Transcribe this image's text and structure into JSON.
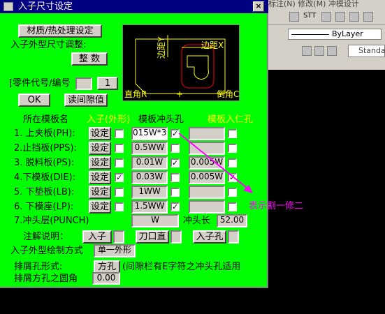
{
  "dialog": {
    "title": "入子尺寸设定",
    "close_glyph": "×",
    "material_button": "材质/热处理设定",
    "shape_adjust_label": "入子外型尺寸调整:",
    "integer_button": "整 数",
    "part_code_label": "[零件代号/编号",
    "part_code_value": "",
    "part_number_value": "1",
    "ok_button": "OK",
    "read_gap_button": "读间隙值",
    "preview": {
      "dim_edge_label": "边距Y",
      "dim_edge_label_x": "边距X",
      "corner_r_label": "直角R",
      "chamfer_label": "倒角C",
      "center_mark": "+"
    },
    "headers": {
      "template_name": "所在模板名",
      "insert_shape": "入子(外形)",
      "punch_hole": "模板冲头孔",
      "insert_hole": "模板入仁孔"
    },
    "rows": [
      {
        "name": "1. 上夹板(PH):",
        "set": "设定",
        "set_checked": false,
        "shape_value": "015W*3",
        "shape_checked": true,
        "punch_value": "",
        "punch_checked": false
      },
      {
        "name": "2.止挡板(PPS):",
        "set": "设定",
        "set_checked": false,
        "shape_value": "0.5WW",
        "shape_checked": false,
        "punch_value": "",
        "punch_checked": false
      },
      {
        "name": "3. 脱料板(PS):",
        "set": "设定",
        "set_checked": false,
        "shape_value": "0.01W",
        "shape_checked": true,
        "punch_value": "0.005W",
        "punch_checked": false
      },
      {
        "name": "4.下模板(DIE):",
        "set": "设定",
        "set_checked": true,
        "shape_value": "0.03W",
        "shape_checked": false,
        "punch_value": "0.005W",
        "punch_checked": true
      },
      {
        "name": "5. 下垫板(LB):",
        "set": "设定",
        "set_checked": false,
        "shape_value": "1WW",
        "shape_checked": false,
        "punch_value": "",
        "punch_checked": false
      },
      {
        "name": "6. 下模座(LP):",
        "set": "设定",
        "set_checked": false,
        "shape_value": "1.5WW",
        "shape_checked": true,
        "punch_value": "",
        "punch_checked": false
      }
    ],
    "punch_layer_label": "7.冲头层(PUNCH)",
    "punch_layer_value": "W",
    "punch_length_label": "冲头长",
    "punch_length_value": "52.00",
    "notes_label": "注解说明：",
    "note_buttons": [
      "入子",
      "刀口直",
      "入子孔"
    ],
    "draw_mode_label": "入子外型绘制方式",
    "draw_mode_value": "单一外形",
    "hole_form_label": "排屑孔形式:",
    "hole_form_button": "方孔",
    "hole_form_note": "(间隙栏有E字符之冲头孔适用",
    "hole_radius_label": "排屑方孔之圆角",
    "hole_radius_value": "0.00",
    "check_mark": "✓"
  },
  "annotation": {
    "text": "表示割一修二",
    "color": "#ff00ff"
  },
  "background_app": {
    "menu_text": "标注(N)  修改(M)  冲模设计",
    "layer_value": "ByLayer",
    "style_value": "Standa"
  },
  "colors": {
    "dialog_bg": "#00ff00",
    "title_bg": "#000080",
    "header_yellow": "#ffff00",
    "preview_line": "#ffff00",
    "preview_red": "#ff0000"
  }
}
